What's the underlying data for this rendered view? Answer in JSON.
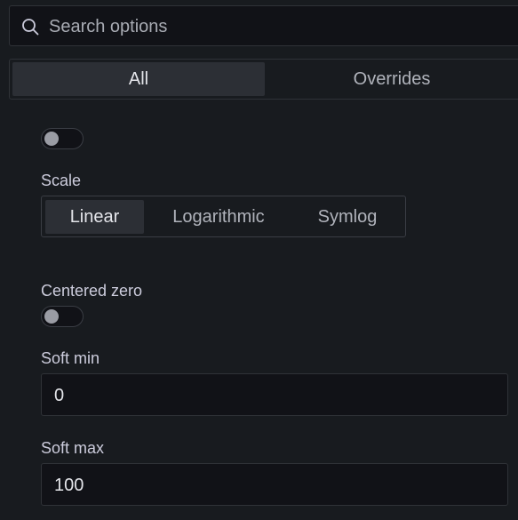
{
  "search": {
    "placeholder": "Search options",
    "value": ""
  },
  "tabs": [
    {
      "label": "All",
      "active": true
    },
    {
      "label": "Overrides",
      "active": false
    }
  ],
  "top_toggle": {
    "on": false
  },
  "scale": {
    "label": "Scale",
    "options": [
      "Linear",
      "Logarithmic",
      "Symlog"
    ],
    "selected": "Linear"
  },
  "centered_zero": {
    "label": "Centered zero",
    "on": false
  },
  "soft_min": {
    "label": "Soft min",
    "value": "0"
  },
  "soft_max": {
    "label": "Soft max",
    "value": "100"
  },
  "icons": {
    "search": "search-icon"
  },
  "colors": {
    "background": "#181b1f",
    "input_bg": "#111217",
    "active_bg": "#2c2f35",
    "border": "#2f3237"
  }
}
